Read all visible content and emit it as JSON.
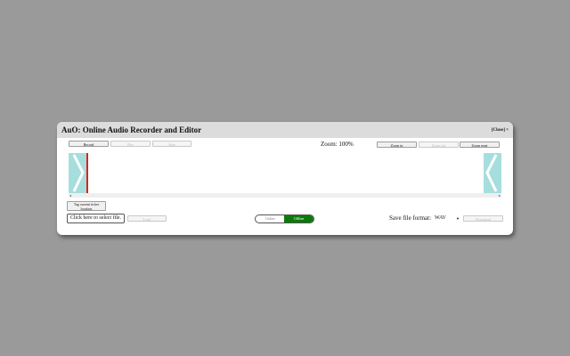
{
  "dialog": {
    "title": "AuO: Online Audio Recorder and Editor",
    "close_label": "[Close] ×"
  },
  "controls": {
    "record": "Record",
    "play": "Play",
    "stop": "Stop",
    "zoom_label": "Zoom: 100%",
    "zoom_in": "Zoom in",
    "zoom_out": "Zoom out",
    "zoom_reset": "Zoom reset"
  },
  "timeline": {
    "scroll_left": "◂",
    "scroll_right": "▸"
  },
  "bottom": {
    "tag_button": "Tag current ticker location",
    "file_pick": "Click here to select file.",
    "load": "Load",
    "mode_online": "Online",
    "mode_offline": "Offline",
    "save_format_label": "Save file format:",
    "save_format_value": "WAV",
    "download": "Download"
  },
  "colors": {
    "handle": "#a6dede",
    "cursor": "#e02020",
    "offline_active": "#0b7a0b"
  }
}
